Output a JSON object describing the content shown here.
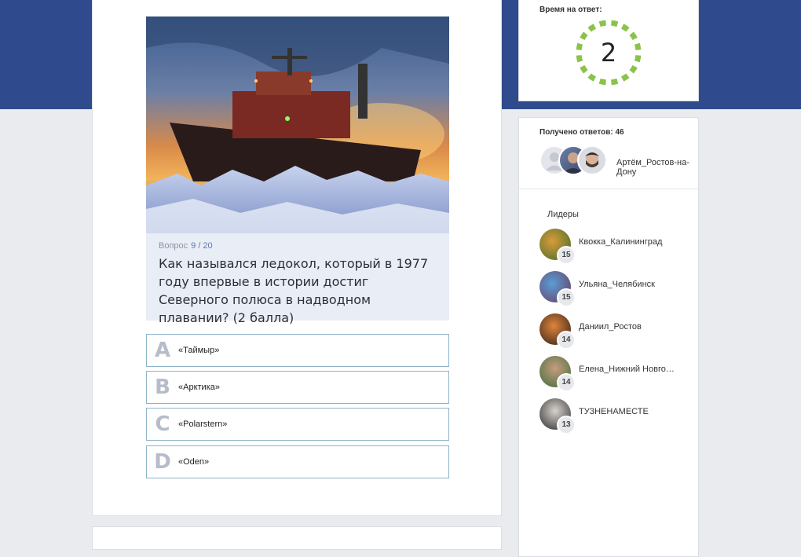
{
  "question": {
    "counter_label": "Вопрос",
    "counter_value": "9 / 20",
    "text": "Как назывался ледокол, который в 1977 году впервые в истории достиг Северного полюса в надводном плавании? (2 балла)",
    "options": [
      {
        "letter": "A",
        "text": "«Таймыр»"
      },
      {
        "letter": "B",
        "text": "«Арктика»"
      },
      {
        "letter": "C",
        "text": "«Polarstern»"
      },
      {
        "letter": "D",
        "text": "«Oden»"
      }
    ]
  },
  "timer": {
    "label": "Время на ответ:",
    "value": "2",
    "fraction_remaining": 1.0,
    "ring_color": "#8bc34a"
  },
  "answers": {
    "label": "Получено ответов: 46",
    "latest_user": "Артём_Ростов-на-Дону"
  },
  "leaders": {
    "label": "Лидеры",
    "items": [
      {
        "name": "Квокка_Калининград",
        "score": "15"
      },
      {
        "name": "Ульяна_Челябинск",
        "score": "15"
      },
      {
        "name": "Даниил_Ростов",
        "score": "14"
      },
      {
        "name": "Елена_Нижний Новго…",
        "score": "14"
      },
      {
        "name": "TУЗНЕНАМЕСТЕ",
        "score": "13"
      }
    ]
  },
  "colors": {
    "header_band": "#2f4b8d",
    "option_border": "#8fb3c9",
    "question_bg": "#e9edf5"
  }
}
